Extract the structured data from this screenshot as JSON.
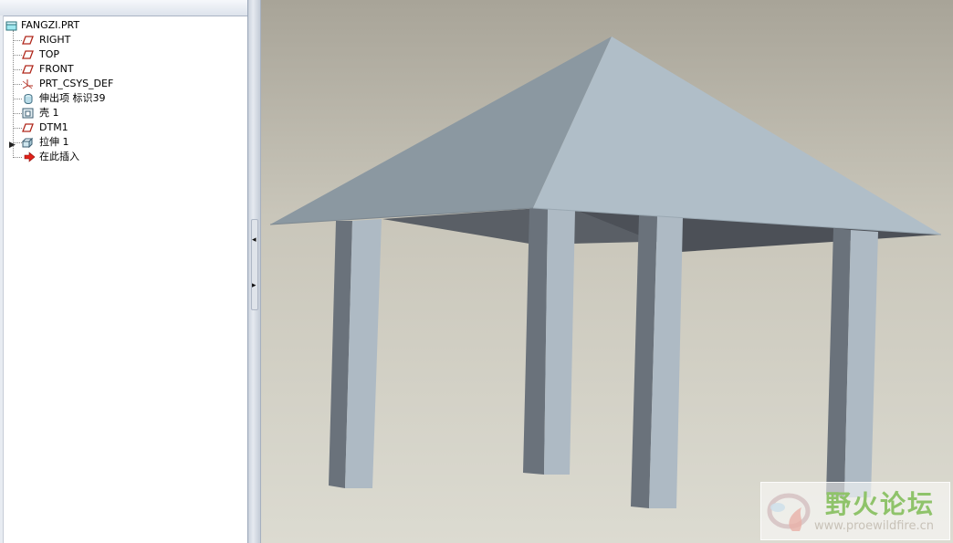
{
  "model_tree": {
    "root": {
      "label": "FANGZI.PRT",
      "icon": "part-icon"
    },
    "items": [
      {
        "label": "RIGHT",
        "icon": "datum-plane-icon"
      },
      {
        "label": "TOP",
        "icon": "datum-plane-icon"
      },
      {
        "label": "FRONT",
        "icon": "datum-plane-icon"
      },
      {
        "label": "PRT_CSYS_DEF",
        "icon": "coordinate-system-icon"
      },
      {
        "label": "伸出项 标识39",
        "icon": "protrusion-icon"
      },
      {
        "label": "壳 1",
        "icon": "shell-icon"
      },
      {
        "label": "DTM1",
        "icon": "datum-plane-icon"
      },
      {
        "label": "拉伸 1",
        "icon": "extrude-icon"
      },
      {
        "label": "在此插入",
        "icon": "insert-here-arrow-icon"
      }
    ]
  },
  "viewport": {
    "model": "pavilion with pyramid roof and four pillars",
    "colors": {
      "background_top": "#a8a498",
      "background_bottom": "#dcdbd1",
      "roof_light": "#b0bec8",
      "roof_dark": "#8b98a1",
      "pillar_light": "#aebac4",
      "pillar_dark": "#6a727b",
      "roof_underside": "#565b62"
    }
  },
  "watermark": {
    "title": "野火论坛",
    "url": "www.proewildfire.cn"
  }
}
